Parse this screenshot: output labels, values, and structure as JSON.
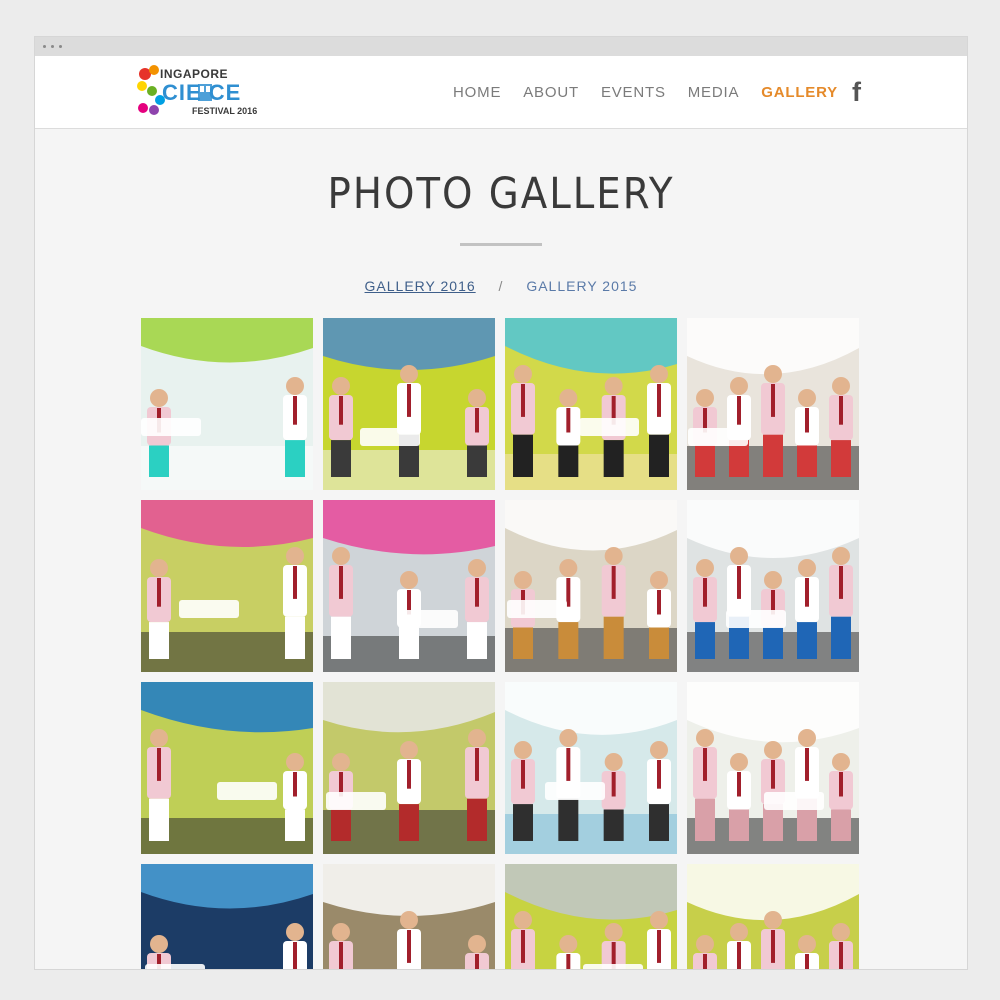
{
  "logo": {
    "line1": "INGAPORE",
    "line2": "CIE  CE",
    "line3": "FESTIVAL 2016",
    "colors": [
      "#e6332a",
      "#f39200",
      "#ffd500",
      "#6ab023",
      "#00a0e3",
      "#8e44ad",
      "#e5007e"
    ]
  },
  "nav": {
    "items": [
      {
        "label": "HOME",
        "active": false
      },
      {
        "label": "ABOUT",
        "active": false
      },
      {
        "label": "EVENTS",
        "active": false
      },
      {
        "label": "MEDIA",
        "active": false
      },
      {
        "label": "GALLERY",
        "active": true
      }
    ],
    "facebook_icon": "facebook-icon",
    "facebook_glyph": "f",
    "active_color": "#e58a2a"
  },
  "page": {
    "title": "PHOTO GALLERY"
  },
  "gallery_tabs": {
    "items": [
      {
        "label": "GALLERY 2016",
        "current": true
      },
      {
        "label": "GALLERY 2015",
        "current": false
      }
    ],
    "separator": "/"
  },
  "photos": [
    {
      "scene": "stage-speaker",
      "palette": [
        "#e8f2ef",
        "#9ed43a",
        "#2bd0c2",
        "#ffffff"
      ]
    },
    {
      "scene": "booth-handshake",
      "palette": [
        "#c7d62f",
        "#4c8cc9",
        "#3a3a3a",
        "#f0f0f0"
      ]
    },
    {
      "scene": "photographer-crowd",
      "palette": [
        "#d2d94a",
        "#4fc4d8",
        "#222222",
        "#f5e3b8"
      ]
    },
    {
      "scene": "exhibit-visit",
      "palette": [
        "#e9e4dc",
        "#ffffff",
        "#d23a3a",
        "#2e2e2e"
      ]
    },
    {
      "scene": "group-pink-floor",
      "palette": [
        "#c8cf63",
        "#e64e98",
        "#ffffff",
        "#2b2b2b"
      ]
    },
    {
      "scene": "group-pink-floor-2",
      "palette": [
        "#cfd4d8",
        "#e8479a",
        "#ffffff",
        "#303030"
      ]
    },
    {
      "scene": "microscope-table",
      "palette": [
        "#dcd6c6",
        "#ffffff",
        "#c98c3a",
        "#333333"
      ]
    },
    {
      "scene": "microscope-crowd",
      "palette": [
        "#dfe3e3",
        "#ffffff",
        "#1f66b6",
        "#333333"
      ]
    },
    {
      "scene": "mall-group",
      "palette": [
        "#bfcf56",
        "#1b7ac8",
        "#ffffff",
        "#2d2d2d"
      ]
    },
    {
      "scene": "demo-device",
      "palette": [
        "#c3c96a",
        "#e8e8e8",
        "#b32b2b",
        "#2d2d2d"
      ]
    },
    {
      "scene": "volunteers-group",
      "palette": [
        "#d6e9ea",
        "#ffffff",
        "#2f2f2f",
        "#7ab9d6"
      ]
    },
    {
      "scene": "microscope-closeup",
      "palette": [
        "#eef0ea",
        "#ffffff",
        "#d9a0a8",
        "#2a2a2a"
      ]
    },
    {
      "scene": "screen-touch",
      "palette": [
        "#1c3c66",
        "#4aa0d8",
        "#ffffff",
        "#2a2a2a"
      ]
    },
    {
      "scene": "drone-demo",
      "palette": [
        "#9a8a6a",
        "#ffffff",
        "#3b3b3b",
        "#c7b58a"
      ]
    },
    {
      "scene": "balloon-lantern",
      "palette": [
        "#c7d341",
        "#bfc5cc",
        "#2a2a2a",
        "#eeeeee"
      ]
    },
    {
      "scene": "booth-icons",
      "palette": [
        "#c7cf4a",
        "#ffffff",
        "#ea6a2f",
        "#3a3a3a"
      ]
    }
  ]
}
